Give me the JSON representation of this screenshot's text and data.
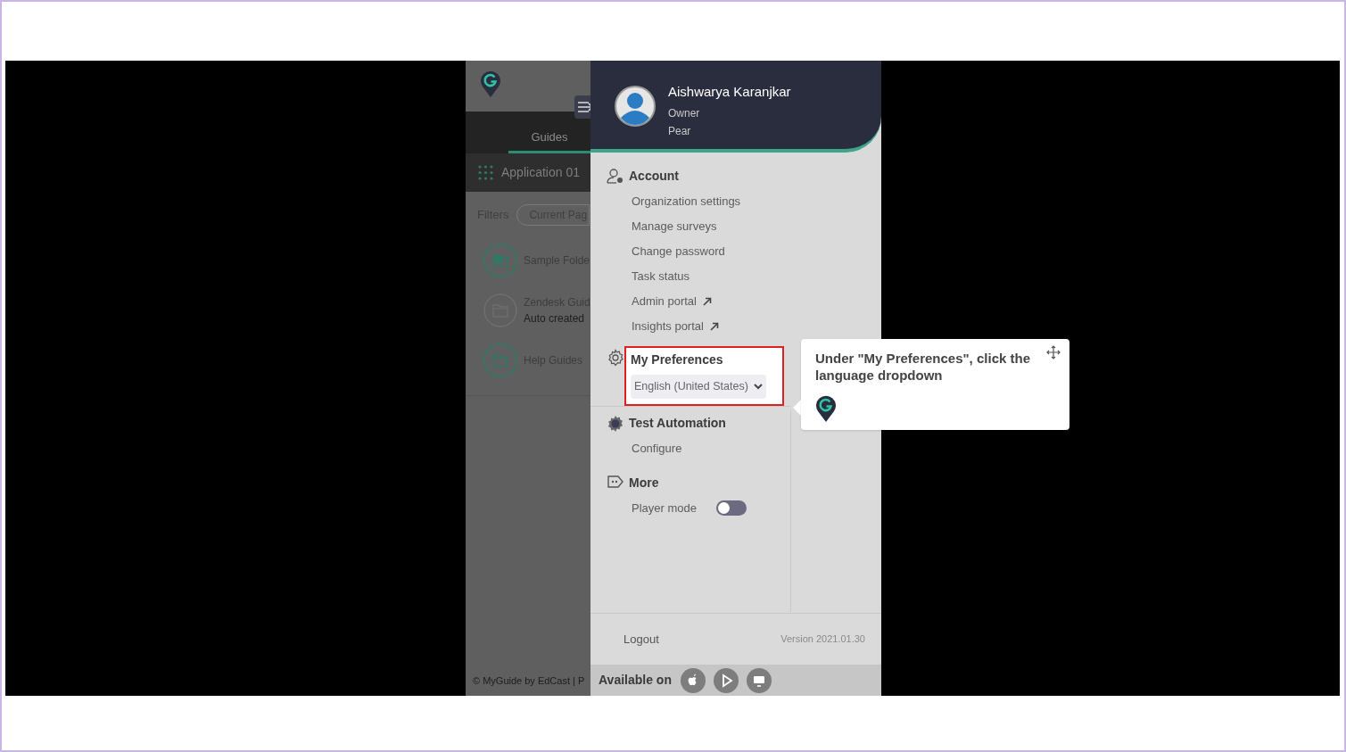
{
  "app_panel": {
    "tab": "Guides",
    "app_name": "Application 01",
    "filters_label": "Filters",
    "filter_chip": "Current Pag",
    "folders": [
      {
        "name": "Sample Folde",
        "kind": "sample"
      },
      {
        "name": "Zendesk Guid",
        "subtitle": "Auto created",
        "kind": "auto"
      },
      {
        "name": "Help Guides",
        "kind": "plain"
      }
    ],
    "footer": "© MyGuide by EdCast | P"
  },
  "profile": {
    "name": "Aishwarya Karanjkar",
    "role": "Owner",
    "org": "Pear"
  },
  "sections": [
    {
      "kind": "account",
      "title": "Account",
      "highlighted": false,
      "items": [
        {
          "kind": "link",
          "label": "Organization settings",
          "external": false
        },
        {
          "kind": "link",
          "label": "Manage surveys",
          "external": false
        },
        {
          "kind": "link",
          "label": "Change password",
          "external": false
        },
        {
          "kind": "link",
          "label": "Task status",
          "external": false
        },
        {
          "kind": "link",
          "label": "Admin portal",
          "external": true
        },
        {
          "kind": "link",
          "label": "Insights portal",
          "external": true
        }
      ]
    },
    {
      "kind": "preferences",
      "title": "My Preferences",
      "highlighted": true,
      "items": [
        {
          "kind": "dropdown",
          "label": "English (United States)"
        }
      ]
    },
    {
      "kind": "automation",
      "title": "Test Automation",
      "highlighted": false,
      "items": [
        {
          "kind": "link",
          "label": "Configure",
          "external": false
        }
      ]
    },
    {
      "kind": "more",
      "title": "More",
      "highlighted": false,
      "items": [
        {
          "kind": "toggle",
          "label": "Player mode",
          "on": false
        }
      ]
    }
  ],
  "footer": {
    "logout": "Logout",
    "version": "Version 2021.01.30",
    "available_on": "Available on"
  },
  "tooltip": {
    "text": "Under \"My Preferences\", click the language dropdown"
  }
}
